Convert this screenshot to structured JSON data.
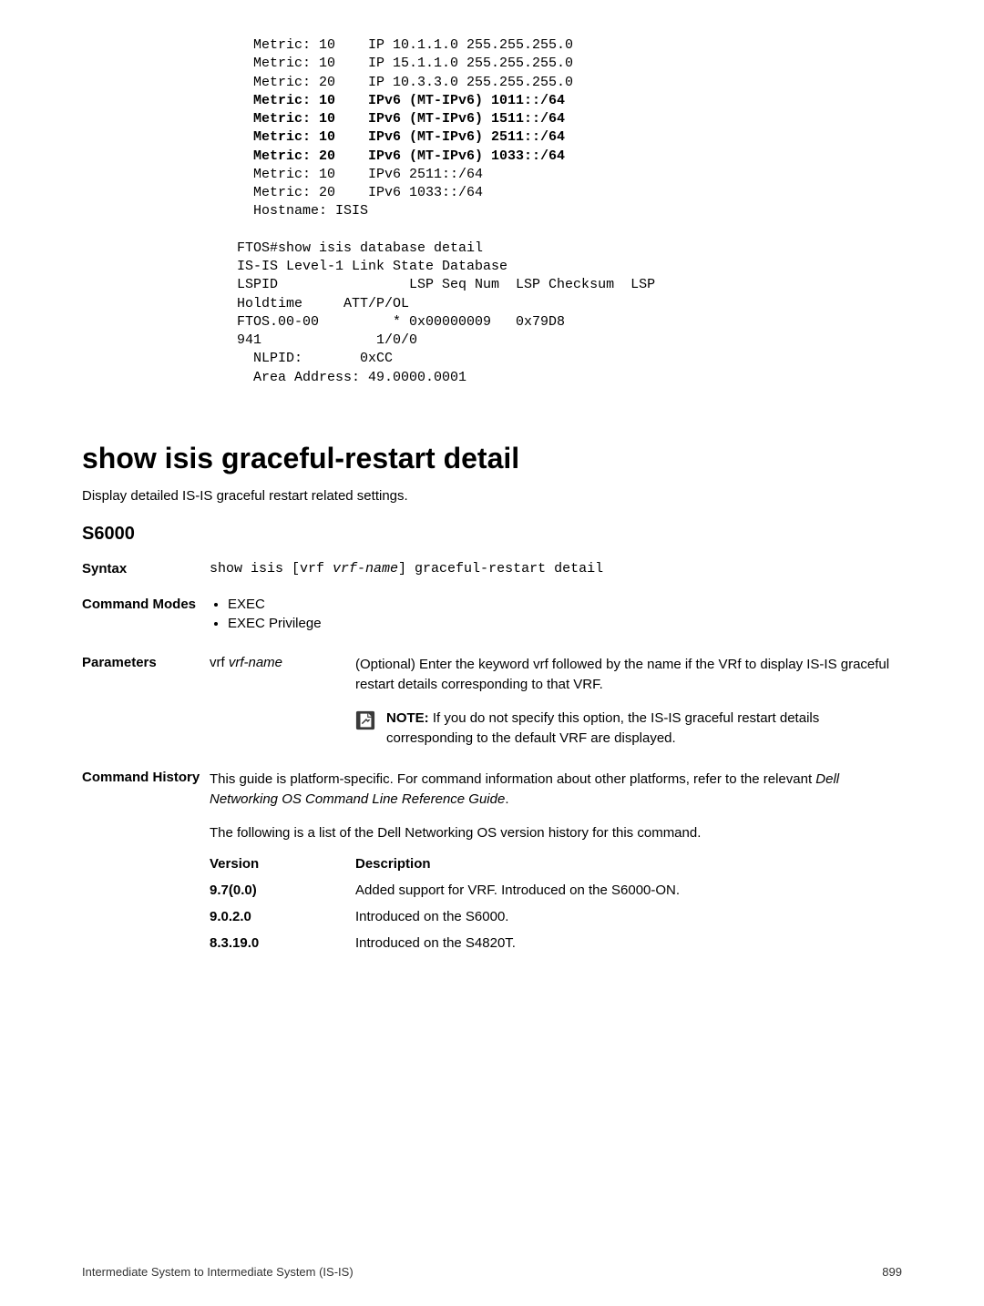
{
  "codeblock": {
    "lines": [
      {
        "text": "  Metric: 10    IP 10.1.1.0 255.255.255.0",
        "bold": false
      },
      {
        "text": "  Metric: 10    IP 15.1.1.0 255.255.255.0",
        "bold": false
      },
      {
        "text": "  Metric: 20    IP 10.3.3.0 255.255.255.0",
        "bold": false
      },
      {
        "text": "  Metric: 10    IPv6 (MT-IPv6) 1011::/64",
        "bold": true
      },
      {
        "text": "  Metric: 10    IPv6 (MT-IPv6) 1511::/64",
        "bold": true
      },
      {
        "text": "  Metric: 10    IPv6 (MT-IPv6) 2511::/64",
        "bold": true
      },
      {
        "text": "  Metric: 20    IPv6 (MT-IPv6) 1033::/64",
        "bold": true
      },
      {
        "text": "  Metric: 10    IPv6 2511::/64",
        "bold": false
      },
      {
        "text": "  Metric: 20    IPv6 1033::/64",
        "bold": false
      },
      {
        "text": "  Hostname: ISIS",
        "bold": false
      },
      {
        "text": "",
        "bold": false
      },
      {
        "text": "FTOS#show isis database detail",
        "bold": false
      },
      {
        "text": "IS-IS Level-1 Link State Database",
        "bold": false
      },
      {
        "text": "LSPID                LSP Seq Num  LSP Checksum  LSP ",
        "bold": false
      },
      {
        "text": "Holdtime     ATT/P/OL",
        "bold": false
      },
      {
        "text": "FTOS.00-00         * 0x00000009   0x79D8        ",
        "bold": false
      },
      {
        "text": "941              1/0/0",
        "bold": false
      },
      {
        "text": "  NLPID:       0xCC",
        "bold": false
      },
      {
        "text": "  Area Address: 49.0000.0001",
        "bold": false
      }
    ]
  },
  "section": {
    "title": "show isis graceful-restart detail",
    "desc": "Display detailed IS-IS graceful restart related settings.",
    "subhead": "S6000"
  },
  "syntax": {
    "label": "Syntax",
    "cmd_pre": "show isis [vrf ",
    "cmd_ital": "vrf-name",
    "cmd_post": "] graceful-restart detail"
  },
  "modes": {
    "label": "Command Modes",
    "items": [
      "EXEC",
      "EXEC Privilege"
    ]
  },
  "params": {
    "label": "Parameters",
    "name_keyword": "vrf ",
    "name_ital": "vrf-name",
    "desc": "(Optional) Enter the keyword vrf followed by the name if the VRf to display IS-IS graceful restart details corresponding to that VRF.",
    "note_label": "NOTE: ",
    "note_text": "If you do not specify this option, the IS-IS graceful restart details corresponding to the default VRF are displayed."
  },
  "history": {
    "label": "Command History",
    "desc_pre": "This guide is platform-specific. For command information about other platforms, refer to the relevant ",
    "desc_ital": "Dell Networking OS Command Line Reference Guide",
    "desc_post": ".",
    "note2": "The following is a list of the Dell Networking OS version history for this command.",
    "header_version": "Version",
    "header_desc": "Description",
    "rows": [
      {
        "v": "9.7(0.0)",
        "d": "Added support for VRF. Introduced on the S6000-ON."
      },
      {
        "v": "9.0.2.0",
        "d": "Introduced on the S6000."
      },
      {
        "v": "8.3.19.0",
        "d": "Introduced on the S4820T."
      }
    ]
  },
  "footer": {
    "left": "Intermediate System to Intermediate System (IS-IS)",
    "right": "899"
  }
}
